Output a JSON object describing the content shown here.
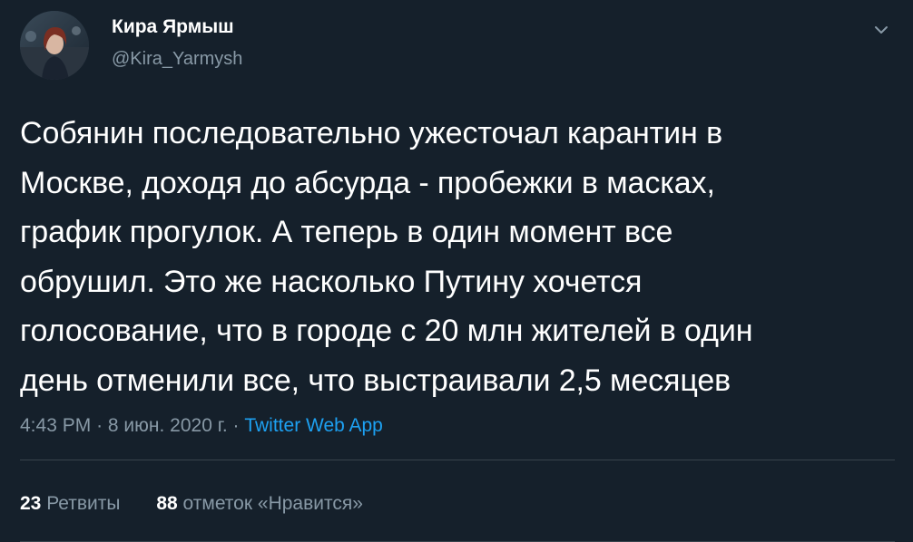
{
  "author": {
    "display_name": "Кира Ярмыш",
    "handle": "@Kira_Yarmysh",
    "avatar_icon": "profile-photo"
  },
  "menu_icon": "chevron-down-icon",
  "tweet": {
    "text": "Собянин последовательно ужесточал карантин в\nМоскве, доходя до абсурда - пробежки в масках,\nграфик прогулок. А теперь в один момент все\nобрушил. Это же насколько Путину хочется\nголосование, что в городе с 20 млн жителей в один\nдень отменили все, что выстраивали 2,5 месяцев",
    "time": "4:43 PM",
    "date": "8 июн. 2020 г.",
    "separator": "·",
    "source": "Twitter Web App"
  },
  "stats": {
    "retweets_count": "23",
    "retweets_label": "Ретвиты",
    "likes_count": "88",
    "likes_label": "отметок «Нравится»"
  },
  "colors": {
    "background": "#15202b",
    "text": "#ffffff",
    "secondary_text": "#8899a6",
    "link": "#1da1f2",
    "divider": "#38444d"
  }
}
